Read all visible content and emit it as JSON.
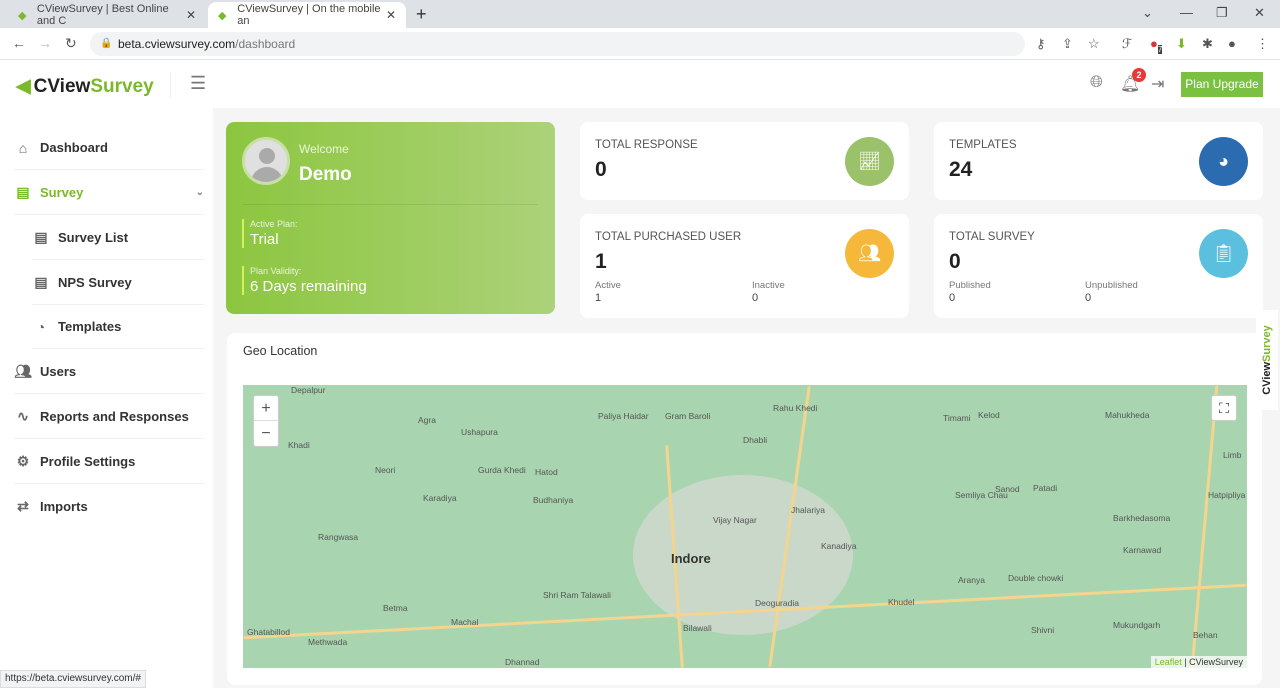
{
  "browser": {
    "tabs": [
      {
        "title": "CViewSurvey | Best Online and C"
      },
      {
        "title": "CViewSurvey | On the mobile an"
      }
    ],
    "url_host": "beta.cviewsurvey.com",
    "url_path": "/dashboard",
    "status_url": "https://beta.cviewsurvey.com/#",
    "extension_badge": "7"
  },
  "header": {
    "logo_a": "CView",
    "logo_b": "Survey",
    "notification_count": "2",
    "upgrade_label": "Plan Upgrade"
  },
  "sidebar": {
    "items": [
      {
        "label": "Dashboard",
        "icon": "home-icon"
      },
      {
        "label": "Survey",
        "icon": "document-icon"
      },
      {
        "label": "Survey List",
        "icon": "document-icon"
      },
      {
        "label": "NPS Survey",
        "icon": "document-icon"
      },
      {
        "label": "Templates",
        "icon": "pie-chart-icon"
      },
      {
        "label": "Users",
        "icon": "users-icon"
      },
      {
        "label": "Reports and Responses",
        "icon": "activity-icon"
      },
      {
        "label": "Profile Settings",
        "icon": "gear-icon"
      },
      {
        "label": "Imports",
        "icon": "swap-icon"
      }
    ]
  },
  "welcome": {
    "greeting": "Welcome",
    "name": "Demo",
    "plan_label": "Active Plan:",
    "plan": "Trial",
    "validity_label": "Plan Validity:",
    "validity": "6 Days remaining"
  },
  "stats": {
    "total_response": {
      "label": "TOTAL RESPONSE",
      "value": "0",
      "color": "#9bc26a"
    },
    "templates": {
      "label": "TEMPLATES",
      "value": "24",
      "color": "#2b6cb0"
    },
    "purchased_user": {
      "label": "TOTAL PURCHASED USER",
      "value": "1",
      "color": "#f6b83a",
      "sub": [
        {
          "label": "Active",
          "value": "1"
        },
        {
          "label": "Inactive",
          "value": "0"
        }
      ]
    },
    "total_survey": {
      "label": "TOTAL SURVEY",
      "value": "0",
      "color": "#5bc0de",
      "sub": [
        {
          "label": "Published",
          "value": "0"
        },
        {
          "label": "Unpublished",
          "value": "0"
        }
      ]
    }
  },
  "geo": {
    "title": "Geo Location",
    "zoom_in": "+",
    "zoom_out": "−",
    "attribution_a": "Leaflet",
    "attribution_b": " | CViewSurvey",
    "places": [
      "Depalpur",
      "Agra",
      "Ushapura",
      "Paliya Haidar",
      "Gram Baroli",
      "Rahu Khedi",
      "Kelod",
      "Timami",
      "Mahukheda",
      "Khadi",
      "Neori",
      "Gurda Khedi",
      "Hatod",
      "Dhabli",
      "Budhaniya",
      "Karadiya",
      "Vijay Nagar",
      "Jhalariya",
      "Semliya Chau",
      "Sanod",
      "Patadi",
      "Barkhedasoma",
      "Rangwasa",
      "Indore",
      "Kanadiya",
      "Karnawad",
      "Shri Ram Talawali",
      "Deoguradia",
      "Aranya",
      "Double chowki",
      "Khudel",
      "Betma",
      "Machal",
      "Ghatabillod",
      "Methwada",
      "Bilawali",
      "Dhannad",
      "Shivni",
      "Mukundgarh",
      "Behan",
      "Hatpipliya",
      "Limb"
    ]
  },
  "brand_side_tab": {
    "a": "CView",
    "b": "Survey"
  }
}
